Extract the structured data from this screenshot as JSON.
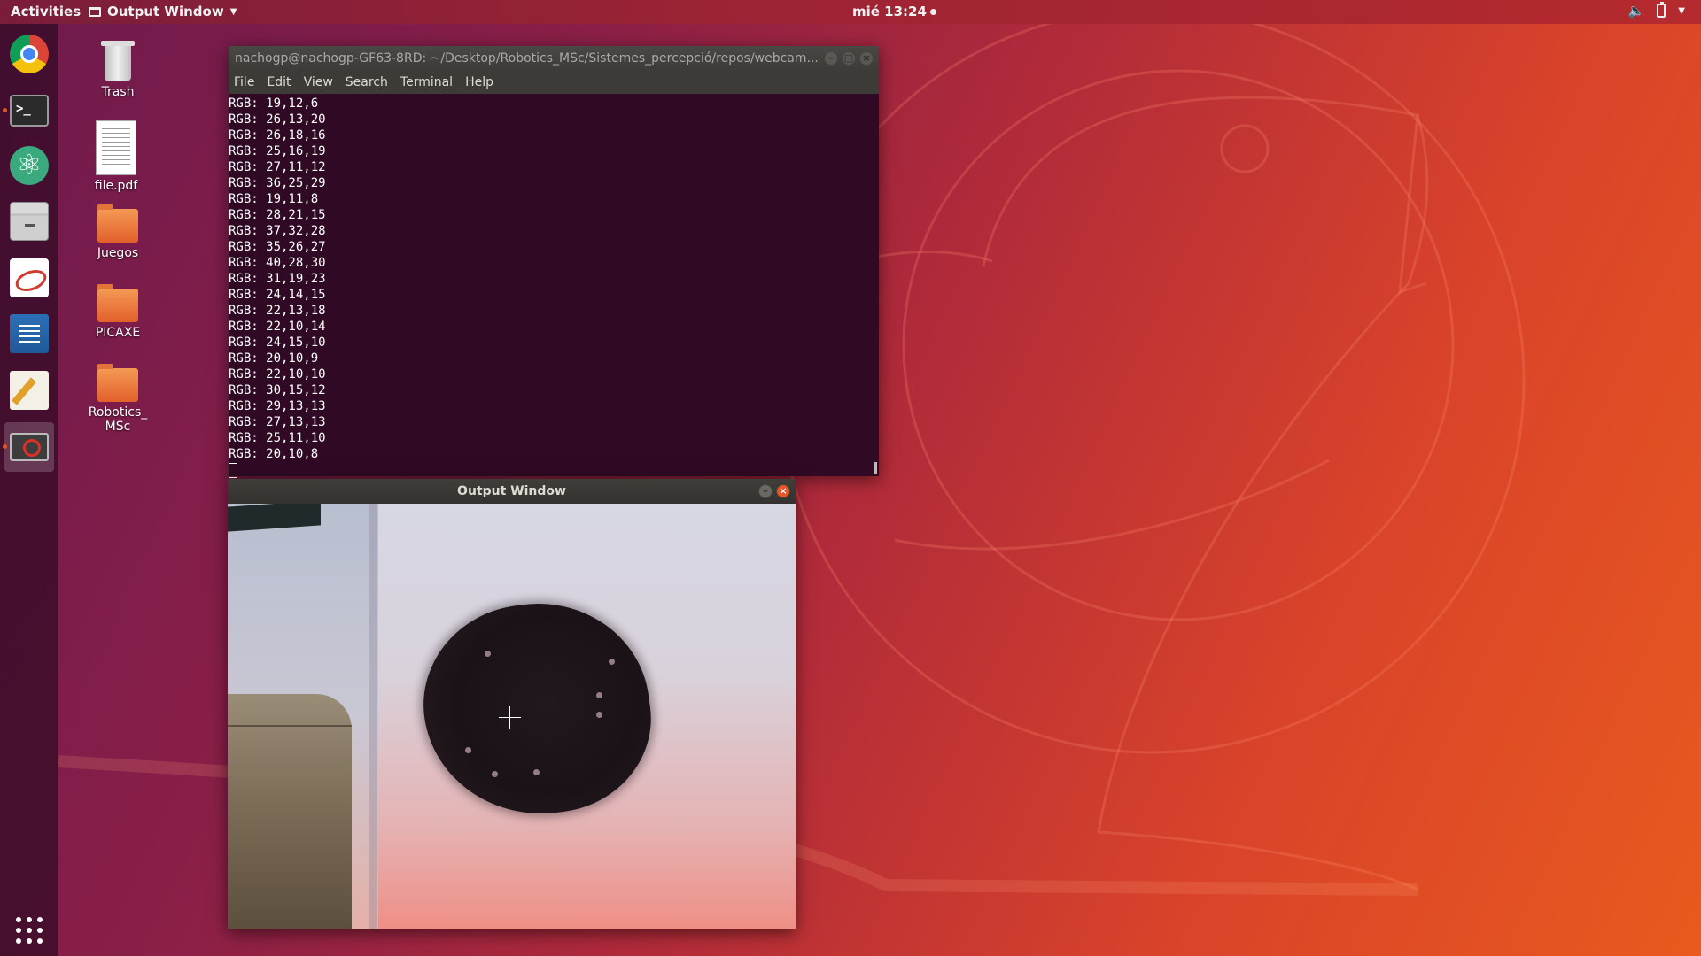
{
  "topbar": {
    "activities": "Activities",
    "app_menu": "Output Window",
    "clock": "mié 13:24"
  },
  "dock": {
    "items": [
      {
        "name": "Google Chrome",
        "icon": "chrome-icon"
      },
      {
        "name": "Terminal",
        "icon": "terminal-icon",
        "running": true
      },
      {
        "name": "Atom",
        "icon": "atom-icon"
      },
      {
        "name": "Files",
        "icon": "files-icon"
      },
      {
        "name": "Document Viewer",
        "icon": "evince-icon"
      },
      {
        "name": "LibreOffice Writer",
        "icon": "writer-icon"
      },
      {
        "name": "Text Editor",
        "icon": "text-editor-icon"
      },
      {
        "name": "Output Window",
        "icon": "camera-app-icon",
        "running": true,
        "active": true
      }
    ],
    "terminal_glyph": ">_"
  },
  "desktop": {
    "icons": [
      {
        "label": "Trash"
      },
      {
        "label": "file.pdf"
      },
      {
        "label": "Juegos"
      },
      {
        "label": "PICAXE"
      },
      {
        "label": "Robotics_\nMSc"
      }
    ]
  },
  "terminal": {
    "title": "nachogp@nachogp-GF63-8RD: ~/Desktop/Robotics_MSc/Sistemes_percepció/repos/webcam...",
    "menu": [
      "File",
      "Edit",
      "View",
      "Search",
      "Terminal",
      "Help"
    ],
    "lines": [
      "RGB: 19,12,6",
      "RGB: 26,13,20",
      "RGB: 26,18,16",
      "RGB: 25,16,19",
      "RGB: 27,11,12",
      "RGB: 36,25,29",
      "RGB: 19,11,8",
      "RGB: 28,21,15",
      "RGB: 37,32,28",
      "RGB: 35,26,27",
      "RGB: 40,28,30",
      "RGB: 31,19,23",
      "RGB: 24,14,15",
      "RGB: 22,13,18",
      "RGB: 22,10,14",
      "RGB: 24,15,10",
      "RGB: 20,10,9",
      "RGB: 22,10,10",
      "RGB: 30,15,12",
      "RGB: 29,13,13",
      "RGB: 27,13,13",
      "RGB: 25,11,10",
      "RGB: 20,10,8"
    ]
  },
  "output_window": {
    "title": "Output Window"
  },
  "colors": {
    "terminal_bg": "#300a24",
    "ubuntu_orange": "#e95420",
    "dock_bg": "#300a24"
  }
}
